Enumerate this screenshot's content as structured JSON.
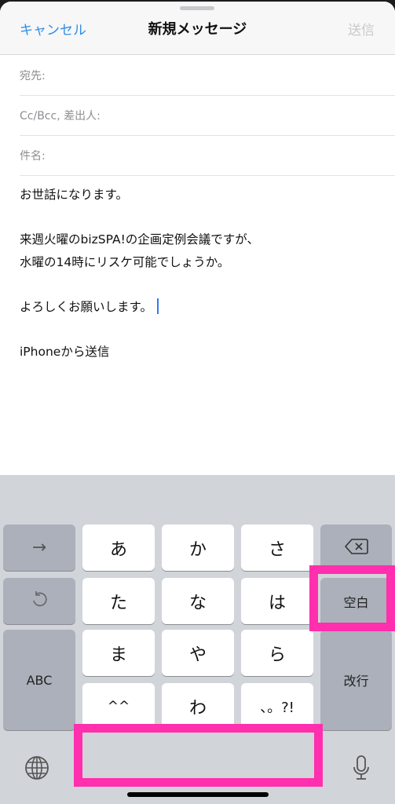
{
  "navbar": {
    "cancel_label": "キャンセル",
    "title": "新規メッセージ",
    "send_label": "送信",
    "accent_color": "#2f8ee8"
  },
  "fields": {
    "to_label": "宛先:",
    "cc_label": "Cc/Bcc, 差出人:",
    "subject_label": "件名:"
  },
  "body": {
    "lines": [
      "お世話になります。",
      "",
      "来週火曜のbizSPA!の企画定例会議ですが、",
      "水曜の14時にリスケ可能でしょうか。",
      "",
      "よろしくお願いします。",
      "",
      "iPhoneから送信"
    ]
  },
  "keyboard": {
    "left_column": {
      "next_icon": "arrow-right-icon",
      "next_glyph": "→",
      "undo_icon": "undo-icon",
      "undo_glyph": "↺",
      "abc_label": "ABC"
    },
    "kana_keys": {
      "row1": [
        "あ",
        "か",
        "さ"
      ],
      "row2": [
        "た",
        "な",
        "は"
      ],
      "row3": [
        "ま",
        "や",
        "ら"
      ],
      "row4": [
        "^^",
        "わ",
        "、。?!"
      ]
    },
    "right_column": {
      "delete_icon": "backspace-icon",
      "space_label": "空白",
      "return_label": "改行"
    },
    "bottom": {
      "globe_icon": "globe-icon",
      "mic_icon": "microphone-icon"
    }
  },
  "annotations": {
    "highlight_color": "#ff2fae",
    "highlighted": [
      "space-key",
      "bottom-space-area"
    ]
  }
}
